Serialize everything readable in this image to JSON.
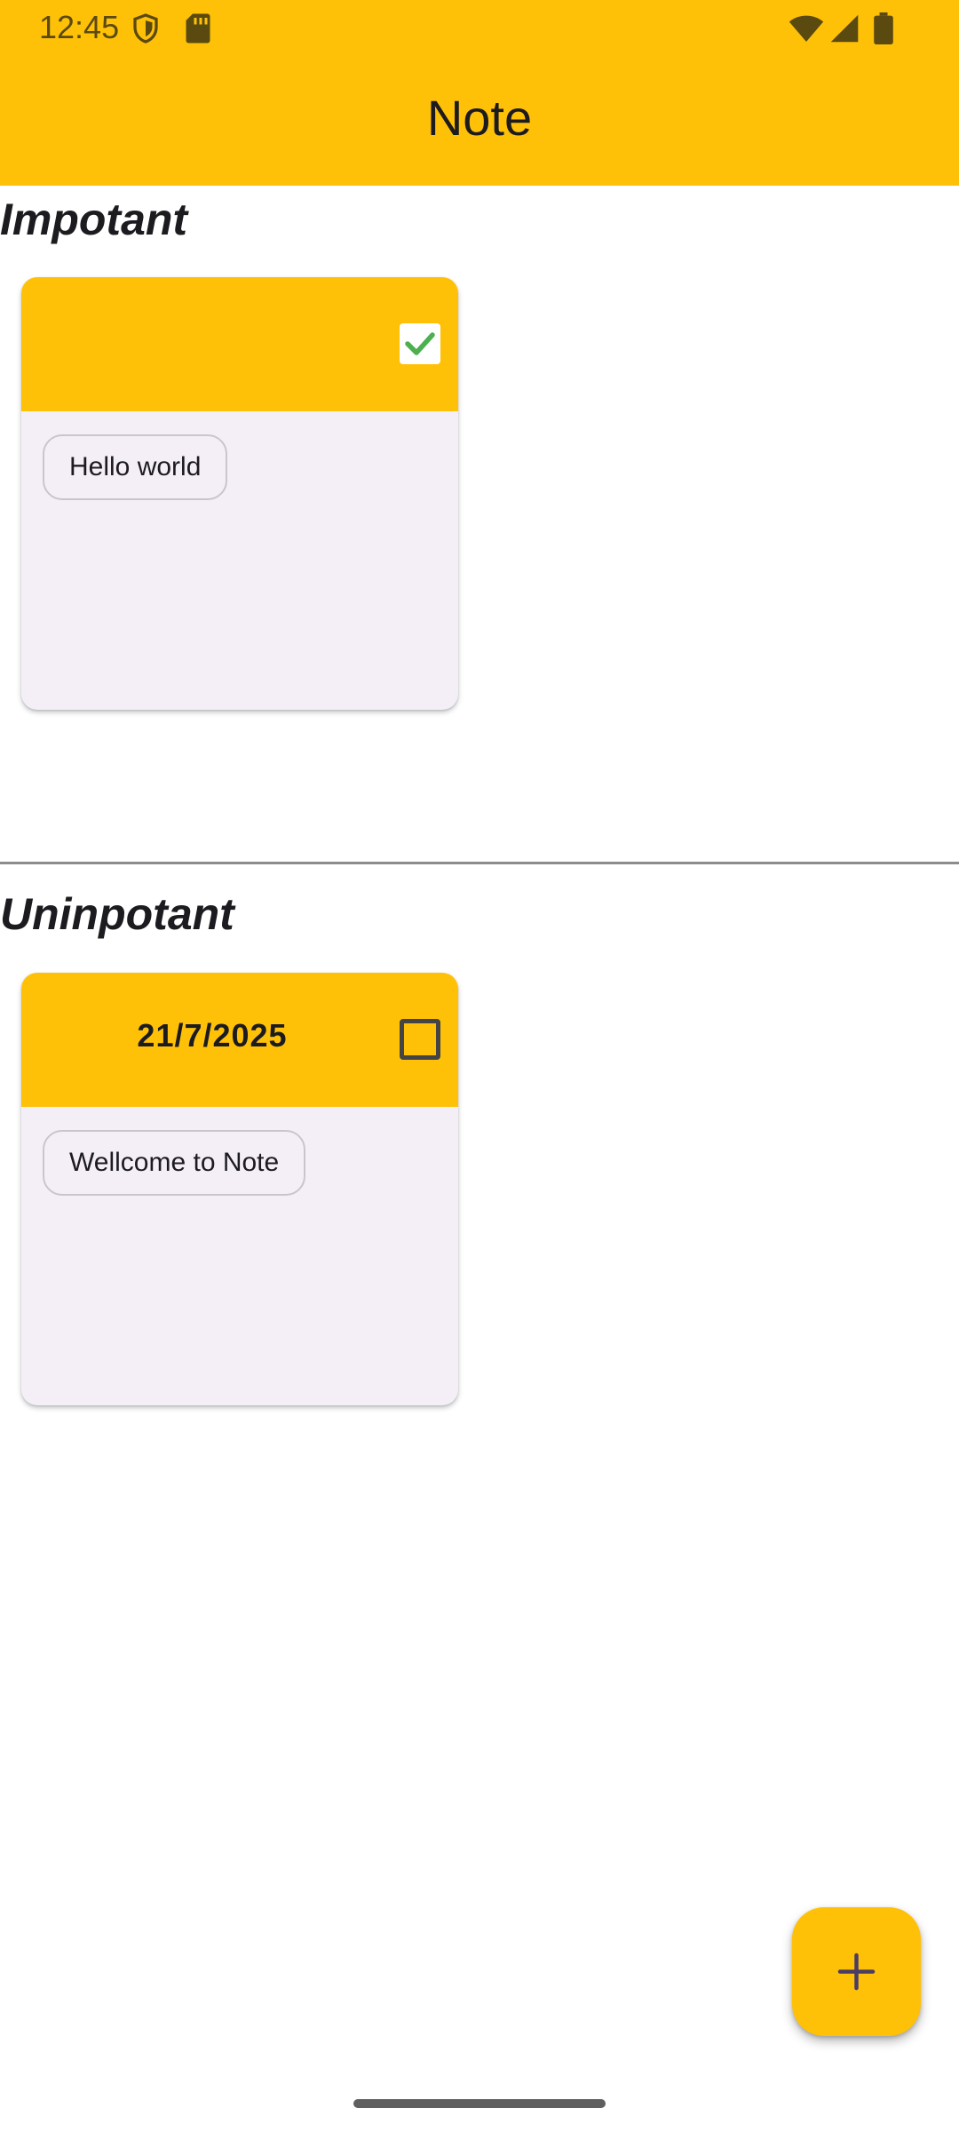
{
  "status_bar": {
    "time": "12:45",
    "left_icons": [
      "shield-icon",
      "sd-card-icon"
    ],
    "right_icons": [
      "wifi-icon",
      "cellular-signal-icon",
      "battery-icon"
    ]
  },
  "app_bar": {
    "title": "Note",
    "background_color": "#FFC107"
  },
  "sections": [
    {
      "title": "Impotant",
      "notes": [
        {
          "date": "",
          "checked": true,
          "content": "Hello world"
        }
      ]
    },
    {
      "title": "Uninpotant",
      "notes": [
        {
          "date": "21/7/2025",
          "checked": false,
          "content": "Wellcome to Note"
        }
      ]
    }
  ],
  "fab": {
    "icon": "plus-icon"
  },
  "colors": {
    "accent": "#FFC107",
    "card_background": "#F4EFF6",
    "check_green": "#4CAF50"
  }
}
